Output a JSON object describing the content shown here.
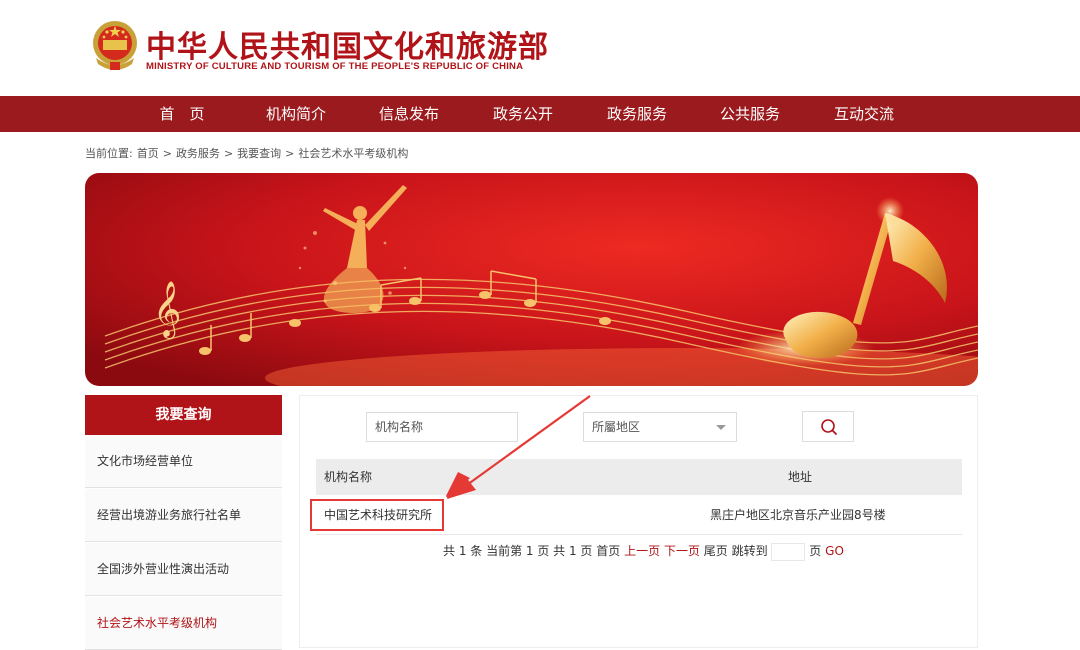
{
  "header": {
    "title": "中华人民共和国文化和旅游部",
    "subtitle": "MINISTRY OF CULTURE AND TOURISM OF THE PEOPLE'S REPUBLIC OF CHINA"
  },
  "nav": {
    "items": [
      "首　页",
      "机构简介",
      "信息发布",
      "政务公开",
      "政务服务",
      "公共服务",
      "互动交流"
    ]
  },
  "breadcrumb": {
    "prefix": "当前位置:",
    "items": [
      "首页",
      ">",
      "政务服务",
      ">",
      "我要查询",
      ">",
      "社会艺术水平考级机构"
    ]
  },
  "sidebar": {
    "heading": "我要查询",
    "items": [
      {
        "label": "文化市场经营单位"
      },
      {
        "label": "经营出境游业务旅行社名单"
      },
      {
        "label": "全国涉外营业性演出活动"
      },
      {
        "label": "社会艺术水平考级机构"
      }
    ]
  },
  "search": {
    "name_placeholder": "机构名称",
    "region_selected": "所屬地区"
  },
  "table": {
    "columns": [
      "机构名称",
      "地址"
    ],
    "rows": [
      {
        "name": "中国艺术科技研究所",
        "address": "黑庄户地区北京音乐产业园8号楼"
      }
    ]
  },
  "pager": {
    "summary": "共 1 条 当前第 1 页 共 1 页",
    "first": "首页",
    "prev": "上一页",
    "next": "下一页",
    "last": "尾页",
    "jump_label": "跳转到",
    "page_unit": "页",
    "go": "GO"
  },
  "colors": {
    "brand_red": "#b01418",
    "nav_bg": "#9b1a1d",
    "annotation": "#e53935"
  }
}
